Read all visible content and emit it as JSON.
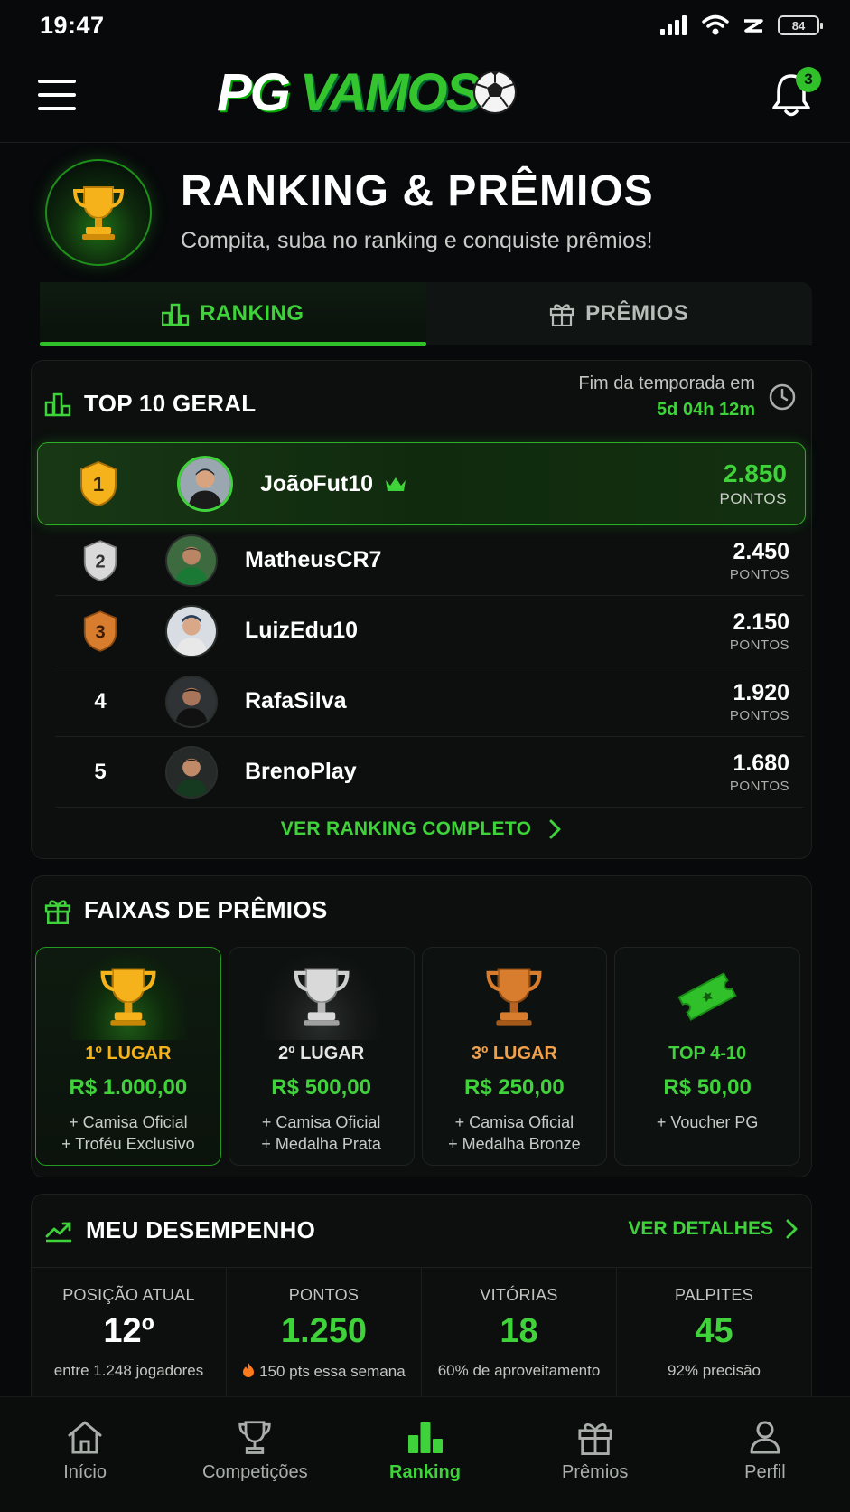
{
  "status_bar": {
    "time": "19:47",
    "battery": "84"
  },
  "header": {
    "logo_pg": "PG",
    "logo_vamos": "VAMOS",
    "notifications_count": "3"
  },
  "hero": {
    "title": "RANKING & PRÊMIOS",
    "subtitle": "Compita, suba no ranking e conquiste prêmios!"
  },
  "tabs": [
    {
      "label": "RANKING",
      "active": true
    },
    {
      "label": "PRÊMIOS",
      "active": false
    }
  ],
  "ranking": {
    "title": "TOP 10 GERAL",
    "season_label": "Fim da temporada em",
    "season_value": "5d 04h 12m",
    "points_label": "PONTOS",
    "rows": [
      {
        "position": "1",
        "name": "JoãoFut10",
        "points": "2.850"
      },
      {
        "position": "2",
        "name": "MatheusCR7",
        "points": "2.450"
      },
      {
        "position": "3",
        "name": "LuizEdu10",
        "points": "2.150"
      },
      {
        "position": "4",
        "name": "RafaSilva",
        "points": "1.920"
      },
      {
        "position": "5",
        "name": "BrenoPlay",
        "points": "1.680"
      }
    ],
    "see_all": "VER RANKING COMPLETO"
  },
  "prizes": {
    "title": "FAIXAS DE PRÊMIOS",
    "tiers": [
      {
        "place": "1º LUGAR",
        "amount": "R$ 1.000,00",
        "extra1": "+ Camisa Oficial",
        "extra2": "+ Troféu Exclusivo",
        "color": "#f5b21a"
      },
      {
        "place": "2º LUGAR",
        "amount": "R$ 500,00",
        "extra1": "+ Camisa Oficial",
        "extra2": "+ Medalha Prata",
        "color": "#e6e6e6"
      },
      {
        "place": "3º LUGAR",
        "amount": "R$ 250,00",
        "extra1": "+ Camisa Oficial",
        "extra2": "+ Medalha Bronze",
        "color": "#f0a14a"
      },
      {
        "place": "TOP 4-10",
        "amount": "R$ 50,00",
        "extra1": "+ Voucher PG",
        "extra2": "",
        "color": "#3fd23a"
      }
    ]
  },
  "performance": {
    "title": "MEU DESEMPENHO",
    "details_link": "VER DETALHES",
    "stats": [
      {
        "label": "POSIÇÃO ATUAL",
        "value": "12º",
        "sub": "entre 1.248 jogadores"
      },
      {
        "label": "PONTOS",
        "value": "1.250",
        "sub": "150 pts essa semana"
      },
      {
        "label": "VITÓRIAS",
        "value": "18",
        "sub": "60% de aproveitamento"
      },
      {
        "label": "PALPITES",
        "value": "45",
        "sub": "92% precisão"
      }
    ]
  },
  "bottom_nav": [
    {
      "label": "Início",
      "icon": "home-icon"
    },
    {
      "label": "Competições",
      "icon": "trophy-icon"
    },
    {
      "label": "Ranking",
      "icon": "podium-icon",
      "active": true
    },
    {
      "label": "Prêmios",
      "icon": "gift-icon"
    },
    {
      "label": "Perfil",
      "icon": "user-icon"
    }
  ],
  "colors": {
    "accent": "#3fd23a",
    "background": "#07090a",
    "card": "#0c0f0e",
    "gold": "#f5b21a",
    "silver": "#d9d9d9",
    "bronze": "#d87c2e"
  }
}
